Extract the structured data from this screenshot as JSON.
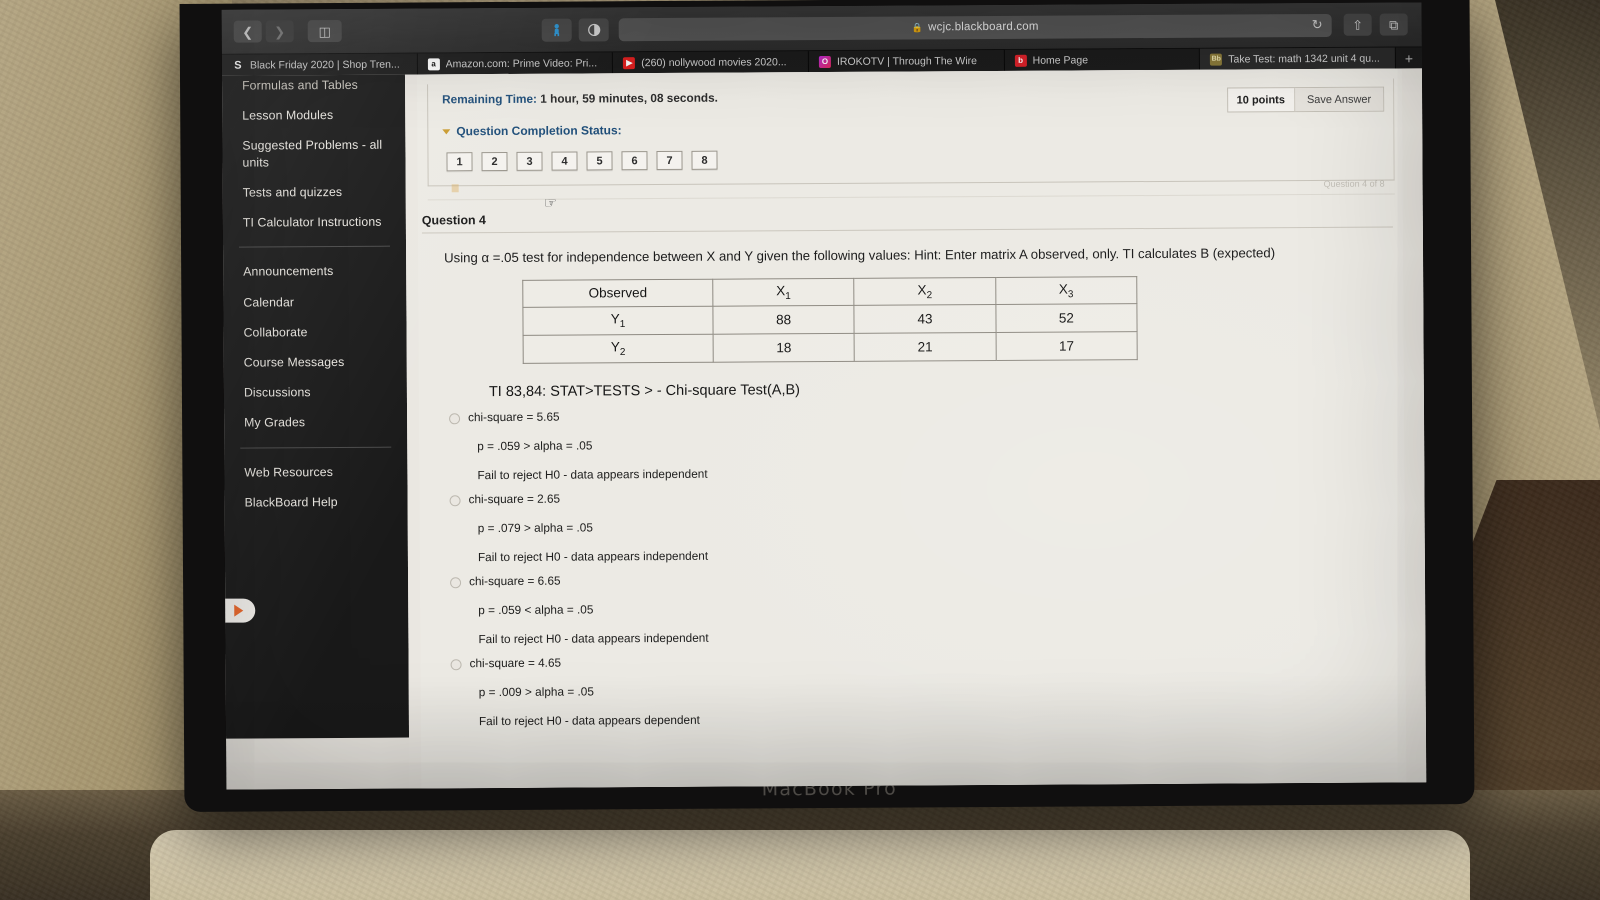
{
  "device": {
    "label": "MacBook Pro"
  },
  "browser": {
    "nav": {
      "back_icon": "chevron-left-icon",
      "forward_icon": "chevron-right-icon",
      "sidebar_icon": "sidebar-toggle-icon"
    },
    "extensions": [
      "extension-icon",
      "reader-contrast-icon"
    ],
    "url": "wcjc.blackboard.com",
    "lock_icon": "lock-icon",
    "reload_icon": "reload-icon",
    "share_icon": "share-icon",
    "tabs_overview_icon": "tabs-overview-icon",
    "new_tab_label": "+",
    "tabs": [
      {
        "label": "Black Friday 2020 | Shop Tren...",
        "favicon": "shopify-s-icon",
        "active": false
      },
      {
        "label": "Amazon.com: Prime Video: Pri...",
        "favicon": "amazon-a-icon",
        "active": false
      },
      {
        "label": "(260) nollywood movies 2020...",
        "favicon": "youtube-icon",
        "active": false
      },
      {
        "label": "IROKOTV | Through The Wire",
        "favicon": "irokotv-icon",
        "active": false
      },
      {
        "label": "Home Page",
        "favicon": "blackboard-icon",
        "active": false
      },
      {
        "label": "Take Test: math 1342 unit 4 qu...",
        "favicon": "blackboard-test-icon",
        "active": true
      }
    ]
  },
  "course_menu": {
    "top_items": [
      "Formulas and Tables",
      "Lesson Modules",
      "Suggested Problems - all units",
      "Tests and quizzes",
      "TI Calculator Instructions"
    ],
    "middle_items": [
      "Announcements",
      "Calendar",
      "Collaborate",
      "Course Messages",
      "Discussions",
      "My Grades"
    ],
    "bottom_items": [
      "Web Resources",
      "BlackBoard Help"
    ],
    "toggle_icon": "expand-menu-arrow-icon"
  },
  "test": {
    "remaining_time_label": "Remaining Time:",
    "remaining_time_value": "1 hour, 59 minutes, 08 seconds.",
    "completion_status_label": "Question Completion Status:",
    "question_numbers": [
      "1",
      "2",
      "3",
      "4",
      "5",
      "6",
      "7",
      "8"
    ],
    "current_question_index": 4,
    "cursor_icon": "pointing-hand-cursor"
  },
  "question": {
    "title": "Question 4",
    "points": "10 points",
    "save_label": "Save Answer",
    "prompt": "Using α  =.05  test for independence between X and Y given the following values:   Hint:  Enter matrix A observed,   only.  TI calculates B (expected)",
    "calculator_hint": "TI 83,84: STAT>TESTS > - Chi-square Test(A,B)"
  },
  "chart_data": {
    "type": "table",
    "title": "Observed",
    "columns": [
      "Observed",
      "X1",
      "X2",
      "X3"
    ],
    "column_labels_display": [
      {
        "main": "Observed",
        "sub": ""
      },
      {
        "main": "X",
        "sub": "1"
      },
      {
        "main": "X",
        "sub": "2"
      },
      {
        "main": "X",
        "sub": "3"
      }
    ],
    "rows": [
      {
        "label_main": "Y",
        "label_sub": "1",
        "values": [
          88,
          43,
          52
        ]
      },
      {
        "label_main": "Y",
        "label_sub": "2",
        "values": [
          18,
          21,
          17
        ]
      }
    ]
  },
  "choices": [
    {
      "line1": "chi-square = 5.65",
      "line2": "p = .059 >  alpha = .05",
      "line3": "Fail to reject H0 - data appears  independent",
      "selected": false
    },
    {
      "line1": "chi-square = 2.65",
      "line2": "p = .079 >  alpha = .05",
      "line3": "Fail to reject H0 - data appears  independent",
      "selected": false
    },
    {
      "line1": "chi-square = 6.65",
      "line2": "p = .059 <  alpha = .05",
      "line3": "Fail to reject H0 - data appears  independent",
      "selected": false
    },
    {
      "line1": "chi-square = 4.65",
      "line2": "p = .009 >  alpha = .05",
      "line3": "Fail to reject H0 - data appears  dependent",
      "selected": false
    }
  ]
}
